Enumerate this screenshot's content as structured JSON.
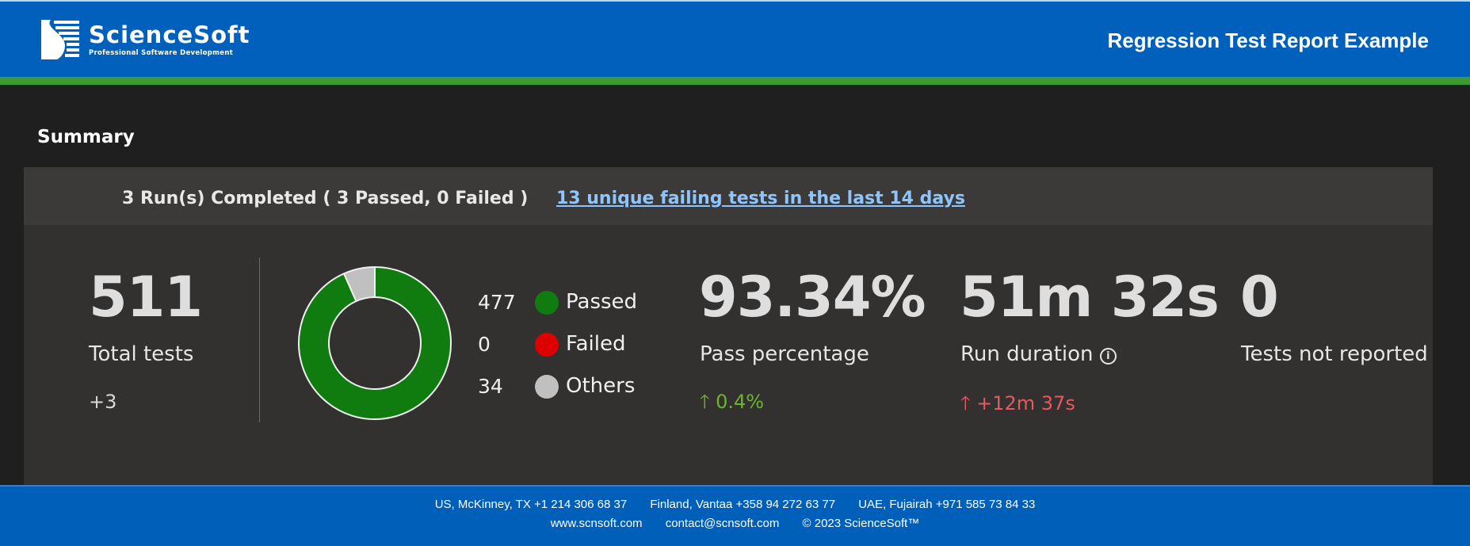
{
  "header": {
    "logo_name": "ScienceSoft",
    "logo_tagline": "Professional Software Development",
    "title": "Regression Test Report Example"
  },
  "summary": {
    "title": "Summary",
    "runs_text": "3 Run(s) Completed ( 3 Passed, 0 Failed )",
    "failing_link": "13 unique failing tests in the last 14 days"
  },
  "metrics": {
    "total": {
      "value": "511",
      "label": "Total tests",
      "delta": "+3"
    },
    "pass": {
      "value": "93.34%",
      "label": "Pass percentage",
      "delta": "0.4%",
      "delta_icon": "arrow-up-icon",
      "delta_color": "#6bb52b"
    },
    "duration": {
      "value": "51m 32s",
      "label": "Run duration",
      "info_icon": "info-icon",
      "delta": "+12m 37s",
      "delta_icon": "arrow-up-icon",
      "delta_color": "#e8585e"
    },
    "not_reported": {
      "value": "0",
      "label": "Tests not reported"
    }
  },
  "chart_data": {
    "type": "pie",
    "donut": true,
    "legend_placement": "right",
    "slices": [
      {
        "name": "Passed",
        "value": 477,
        "color": "#107c10"
      },
      {
        "name": "Failed",
        "value": 0,
        "color": "#dd0000"
      },
      {
        "name": "Others",
        "value": 34,
        "color": "#c0c0c0"
      }
    ]
  },
  "legend": {
    "items": [
      {
        "count": "477",
        "label": "Passed"
      },
      {
        "count": "0",
        "label": "Failed"
      },
      {
        "count": "34",
        "label": "Others"
      }
    ]
  },
  "footer": {
    "line1": "US, McKinney, TX +1 214 306 68 37       Finland, Vantaa +358 94 272 63 77       UAE, Fujairah +971 585 73 84 33",
    "line2": "www.scnsoft.com       contact@scnsoft.com       © 2023 ScienceSoft™"
  }
}
